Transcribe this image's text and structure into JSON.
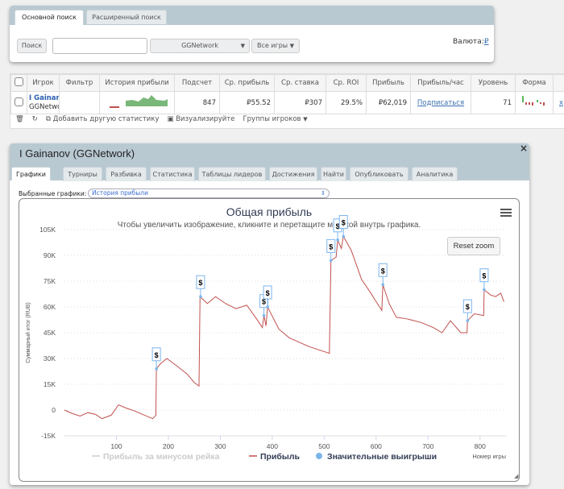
{
  "search": {
    "tabs": [
      "Основной поиск",
      "Расширенный поиск"
    ],
    "search_button": "Поиск",
    "search_value": "",
    "network": "GGNetwork",
    "games": "Все игры",
    "currency_label": "Валюта:",
    "currency_symbol": "₽"
  },
  "table": {
    "headers": [
      "Игрок",
      "Фильтр",
      "История прибыли",
      "Подсчет",
      "Ср. прибыль",
      "Ср. ставка",
      "Ср. ROI",
      "Прибыль",
      "Прибыль/час",
      "Уровень",
      "Форма"
    ],
    "row": {
      "player": "I Gainan",
      "network": "GGNetwo",
      "count": "847",
      "avg_profit": "₽55.52",
      "avg_stake": "₽307",
      "roi": "29.5%",
      "profit": "₽62,019",
      "per_hour": "Подписаться",
      "level": "71",
      "remove": "x"
    },
    "toolbar": {
      "add_stat": "Добавить другую статистику",
      "visualize": "Визуализируйте",
      "groups": "Группы игроков"
    }
  },
  "modal": {
    "title": "I Gainanov (GGNetwork)",
    "close": "×",
    "tabs": [
      "Графики",
      "Турниры",
      "Разбивка",
      "Статистика",
      "Таблицы лидеров",
      "Достижения",
      "Найти",
      "Опубликовать",
      "Аналитика"
    ],
    "selected_label": "Выбранные графики:",
    "selected_value": "История прибыли",
    "reset_zoom": "Reset zoom"
  },
  "chart_data": {
    "type": "line",
    "title": "Общая прибыль",
    "subtitle": "Чтобы увеличить изображение, кликните и перетащите мышкой внутрь графика.",
    "ylabel": "Суммарный итог (RUB)",
    "xlabel": "Номер игры",
    "ylim": [
      -15000,
      105000
    ],
    "xlim": [
      0,
      850
    ],
    "yticks": [
      {
        "v": -15000,
        "l": "-15K"
      },
      {
        "v": 0,
        "l": "0"
      },
      {
        "v": 15000,
        "l": "15K"
      },
      {
        "v": 30000,
        "l": "30K"
      },
      {
        "v": 45000,
        "l": "45K"
      },
      {
        "v": 60000,
        "l": "60K"
      },
      {
        "v": 75000,
        "l": "75K"
      },
      {
        "v": 90000,
        "l": "90K"
      },
      {
        "v": 105000,
        "l": "105K"
      }
    ],
    "xticks": [
      {
        "v": 100,
        "l": "100"
      },
      {
        "v": 200,
        "l": "200"
      },
      {
        "v": 300,
        "l": "300"
      },
      {
        "v": 400,
        "l": "400"
      },
      {
        "v": 500,
        "l": "500"
      },
      {
        "v": 600,
        "l": "600"
      },
      {
        "v": 700,
        "l": "700"
      },
      {
        "v": 800,
        "l": "800"
      }
    ],
    "legend": [
      {
        "name": "Прибыль за минусом рейка",
        "color": "#cccccc"
      },
      {
        "name": "Прибыль",
        "color": "#c0504d"
      },
      {
        "name": "Значительные выигрыши",
        "color": "#7cb5ec"
      }
    ],
    "series": [
      {
        "name": "Прибыль",
        "color": "#c0504d",
        "points": [
          [
            0,
            0
          ],
          [
            15,
            -2000
          ],
          [
            30,
            -3500
          ],
          [
            45,
            -1500
          ],
          [
            60,
            -2500
          ],
          [
            72,
            -5000
          ],
          [
            90,
            -3000
          ],
          [
            104,
            3000
          ],
          [
            120,
            1000
          ],
          [
            135,
            -500
          ],
          [
            150,
            -2500
          ],
          [
            170,
            -5000
          ],
          [
            176,
            -3000
          ],
          [
            177,
            24000
          ],
          [
            185,
            27000
          ],
          [
            197,
            30000
          ],
          [
            215,
            26000
          ],
          [
            236,
            21000
          ],
          [
            250,
            16000
          ],
          [
            259,
            14000
          ],
          [
            261,
            66000
          ],
          [
            275,
            62000
          ],
          [
            291,
            66000
          ],
          [
            310,
            62000
          ],
          [
            330,
            59000
          ],
          [
            351,
            61000
          ],
          [
            370,
            53000
          ],
          [
            381,
            48000
          ],
          [
            384,
            55000
          ],
          [
            388,
            49000
          ],
          [
            391,
            60000
          ],
          [
            413,
            47000
          ],
          [
            433,
            42000
          ],
          [
            448,
            40000
          ],
          [
            470,
            37000
          ],
          [
            490,
            35000
          ],
          [
            510,
            33000
          ],
          [
            513,
            87000
          ],
          [
            523,
            89000
          ],
          [
            526,
            99000
          ],
          [
            533,
            94000
          ],
          [
            537,
            101000
          ],
          [
            552,
            93000
          ],
          [
            572,
            76000
          ],
          [
            590,
            68000
          ],
          [
            598,
            64000
          ],
          [
            611,
            58000
          ],
          [
            613,
            73000
          ],
          [
            625,
            62000
          ],
          [
            639,
            54000
          ],
          [
            660,
            53000
          ],
          [
            686,
            51000
          ],
          [
            710,
            48000
          ],
          [
            727,
            45000
          ],
          [
            743,
            52000
          ],
          [
            763,
            45000
          ],
          [
            775,
            45000
          ],
          [
            776,
            52000
          ],
          [
            789,
            56000
          ],
          [
            807,
            55000
          ],
          [
            808,
            70000
          ],
          [
            820,
            67000
          ],
          [
            830,
            66000
          ],
          [
            840,
            68000
          ],
          [
            846,
            63000
          ]
        ]
      }
    ],
    "significant_wins": [
      [
        177,
        24000
      ],
      [
        262,
        66000
      ],
      [
        384,
        55000
      ],
      [
        391,
        60000
      ],
      [
        513,
        87000
      ],
      [
        526,
        99000
      ],
      [
        537,
        101000
      ],
      [
        613,
        73000
      ],
      [
        776,
        52000
      ],
      [
        808,
        70000
      ]
    ],
    "marker_label": "$"
  }
}
